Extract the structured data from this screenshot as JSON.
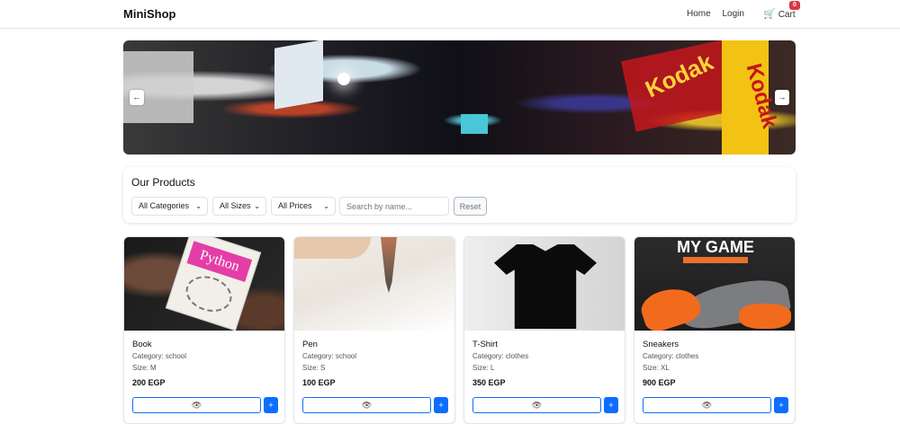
{
  "navbar": {
    "brand": "MiniShop",
    "links": [
      "Home",
      "Login"
    ],
    "cart_label": "Cart",
    "cart_count": "0",
    "cart_icon": "cart-icon"
  },
  "carousel": {
    "prev_label": "←",
    "next_label": "→",
    "slide_text": [
      "Kodak",
      "Kodak"
    ]
  },
  "filters": {
    "title": "Our Products",
    "category_selected": "All Categories",
    "size_selected": "All Sizes",
    "price_selected": "All Prices",
    "search_placeholder": "Search by name...",
    "reset_label": "Reset"
  },
  "products": [
    {
      "name": "Book",
      "category": "Category: school",
      "size": "Size: M",
      "price": "200 EGP",
      "image_text": "Python"
    },
    {
      "name": "Pen",
      "category": "Category: school",
      "size": "Size: S",
      "price": "100 EGP"
    },
    {
      "name": "T-Shirt",
      "category": "Category: clothes",
      "size": "Size: L",
      "price": "350 EGP"
    },
    {
      "name": "Sneakers",
      "category": "Category: clothes",
      "size": "Size: XL",
      "price": "900 EGP",
      "image_text": "MY GAME"
    }
  ],
  "card_actions": {
    "view_icon": "eye-icon",
    "add_label": "+"
  }
}
